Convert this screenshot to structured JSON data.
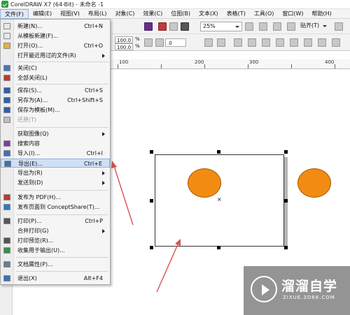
{
  "window": {
    "title": "CorelDRAW X7 (64-Bit) - 未命名 -1"
  },
  "menubar": [
    "文件(F)",
    "编辑(E)",
    "视图(V)",
    "布局(L)",
    "对象(C)",
    "效果(C)",
    "位图(B)",
    "文本(X)",
    "表格(T)",
    "工具(O)",
    "窗口(W)",
    "帮助(H)"
  ],
  "toolbar": {
    "zoom": "25%",
    "snap": "贴齐(T)",
    "w_pct": "100.0",
    "h_pct": "100.0",
    "pct_unit": "%",
    "angle": ".0"
  },
  "ruler": {
    "labels": [
      "100",
      "200",
      "300",
      "400"
    ]
  },
  "file_menu": [
    {
      "label": "新建(N)...",
      "shortcut": "Ctrl+N",
      "icon": "new-doc-icon"
    },
    {
      "label": "从模板新建(F)...",
      "shortcut": "",
      "icon": "template-icon"
    },
    {
      "label": "打开(O)...",
      "shortcut": "Ctrl+O",
      "icon": "open-folder-icon"
    },
    {
      "label": "打开最近用过的文件(R)",
      "shortcut": "",
      "icon": "",
      "submenu": true
    },
    {
      "label": "关闭(C)",
      "shortcut": "",
      "icon": "close-doc-icon"
    },
    {
      "label": "全部关闭(L)",
      "shortcut": "",
      "icon": "close-all-icon"
    },
    {
      "label": "保存(S)...",
      "shortcut": "Ctrl+S",
      "icon": "save-icon"
    },
    {
      "label": "另存为(A)...",
      "shortcut": "Ctrl+Shift+S",
      "icon": "save-as-icon"
    },
    {
      "label": "保存为模板(M)...",
      "shortcut": "",
      "icon": "save-template-icon"
    },
    {
      "label": "还原(T)",
      "shortcut": "",
      "icon": "revert-icon",
      "disabled": true
    },
    {
      "label": "获取图像(Q)",
      "shortcut": "",
      "icon": "",
      "submenu": true
    },
    {
      "label": "搜索内容",
      "shortcut": "",
      "icon": "search-content-icon"
    },
    {
      "label": "导入(I)...",
      "shortcut": "Ctrl+I",
      "icon": "import-icon"
    },
    {
      "label": "导出(E)...",
      "shortcut": "Ctrl+E",
      "icon": "export-icon",
      "highlight": true
    },
    {
      "label": "导出为(R)",
      "shortcut": "",
      "icon": "",
      "submenu": true
    },
    {
      "label": "发送到(D)",
      "shortcut": "",
      "icon": "",
      "submenu": true
    },
    {
      "label": "发布为 PDF(H)...",
      "shortcut": "",
      "icon": "pdf-icon"
    },
    {
      "label": "发布页面到 ConceptShare(T)...",
      "shortcut": "",
      "icon": "conceptshare-icon"
    },
    {
      "label": "打印(P)...",
      "shortcut": "Ctrl+P",
      "icon": "print-icon"
    },
    {
      "label": "合并打印(G)",
      "shortcut": "",
      "icon": "",
      "submenu": true
    },
    {
      "label": "打印预览(R)...",
      "shortcut": "",
      "icon": "print-preview-icon"
    },
    {
      "label": "收集用于输出(U)...",
      "shortcut": "",
      "icon": "collect-output-icon"
    },
    {
      "label": "文档属性(P)...",
      "shortcut": "",
      "icon": "doc-properties-icon"
    },
    {
      "label": "退出(X)",
      "shortcut": "Alt+F4",
      "icon": "exit-icon"
    }
  ],
  "watermark": {
    "title": "溜溜自学",
    "url": "ZIXUE.3D66.COM"
  },
  "colors": {
    "accent_orange": "#F28B12",
    "menu_highlight": "#CFE0F5",
    "arrow_red": "#D9534F"
  }
}
